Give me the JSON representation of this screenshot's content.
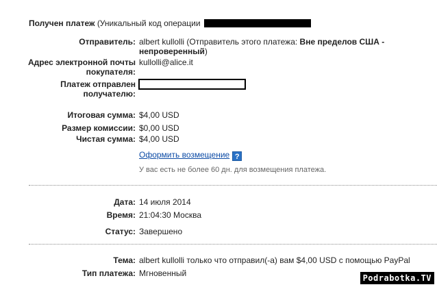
{
  "header": {
    "title": "Получен платеж",
    "subtitle": "(Уникальный код операции"
  },
  "details": {
    "sender_label": "Отправитель:",
    "sender_value_prefix": "albert kullolli (Отправитель этого платежа: ",
    "sender_value_bold": "Вне пределов США - непроверенный",
    "sender_value_suffix": ")",
    "buyer_email_label_line1": "Адрес электронной почты",
    "buyer_email_label_line2": "покупателя:",
    "buyer_email_value": "kullolli@alice.it",
    "sent_to_label_line1": "Платеж отправлен",
    "sent_to_label_line2": "получателю:"
  },
  "amounts": {
    "total_label": "Итоговая сумма:",
    "total_value": "$4,00 USD",
    "fee_label": "Размер комиссии:",
    "fee_value": "$0,00 USD",
    "net_label": "Чистая сумма:",
    "net_value": "$4,00 USD",
    "refund_link": "Оформить возмещение",
    "help_icon_text": "?",
    "refund_note": "У вас есть не более 60 дн. для возмещения платежа."
  },
  "status": {
    "date_label": "Дата:",
    "date_value": "14 июля 2014",
    "time_label": "Время:",
    "time_value": "21:04:30 Москва",
    "status_label": "Статус:",
    "status_value": "Завершено"
  },
  "message": {
    "subject_label": "Тема:",
    "subject_value": "albert kullolli только что отправил(-а) вам $4,00 USD с помощью PayPal",
    "type_label": "Тип платежа:",
    "type_value": "Мгновенный"
  },
  "watermark": "Podrabotka.TV"
}
